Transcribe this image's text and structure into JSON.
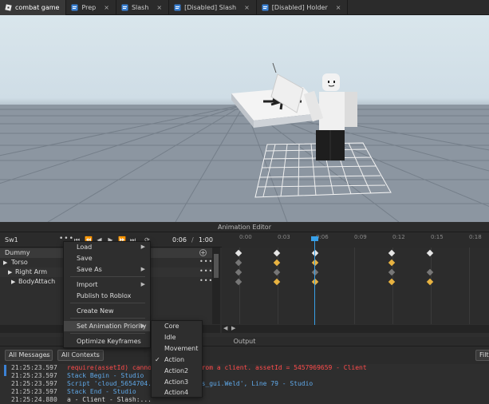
{
  "tabs": [
    {
      "label": "combat game",
      "icon": "roblox-place-icon",
      "active": true
    },
    {
      "label": "Prep",
      "icon": "script-icon"
    },
    {
      "label": "Slash",
      "icon": "script-icon"
    },
    {
      "label": "[Disabled] Slash",
      "icon": "script-icon"
    },
    {
      "label": "[Disabled] Holder",
      "icon": "script-icon"
    }
  ],
  "tab_close": "×",
  "animation_editor": {
    "title": "Animation Editor",
    "animation_name": "Sw1",
    "current_time": "0:06",
    "separator": "/",
    "end_time": "1:00",
    "ruler_labels": [
      "0:00",
      "0:03",
      "0:06",
      "0:09",
      "0:12",
      "0:15",
      "0:18"
    ],
    "tracks": [
      {
        "label": "Dummy"
      },
      {
        "label": "Torso"
      },
      {
        "label": "Right Arm"
      },
      {
        "label": "BodyAttach"
      }
    ]
  },
  "context_menu": {
    "items": [
      "Load",
      "Save",
      "Save As",
      "Import",
      "Publish to Roblox",
      "Create New",
      "Set Animation Priority",
      "Optimize Keyframes"
    ]
  },
  "priority_menu": {
    "items": [
      "Core",
      "Idle",
      "Movement",
      "Action",
      "Action2",
      "Action3",
      "Action4"
    ],
    "checked": "Action"
  },
  "output": {
    "title": "Output",
    "filter_messages": "All Messages",
    "filter_contexts": "All Contexts",
    "filter_label": "Filte",
    "logs": [
      {
        "time": "21:25:23.597",
        "text": "require(assetId) cannot be called from a client.  assetId = 5457969659  -  Client",
        "color": "#ff4b4b"
      },
      {
        "time": "21:25:23.597",
        "text": "Stack Begin  -  Studio",
        "color": "#5fa8e8"
      },
      {
        "time": "21:25:23.597",
        "text": "Script 'cloud_5654704...catalogitems_gui.Weld', Line 79  -  Studio",
        "color": "#5fa8e8"
      },
      {
        "time": "21:25:23.597",
        "text": "Stack End  -  Studio",
        "color": "#5fa8e8"
      },
      {
        "time": "21:25:24.880",
        "text": "a  -  Client - Slash:...",
        "color": "#d8d8d8"
      }
    ]
  }
}
